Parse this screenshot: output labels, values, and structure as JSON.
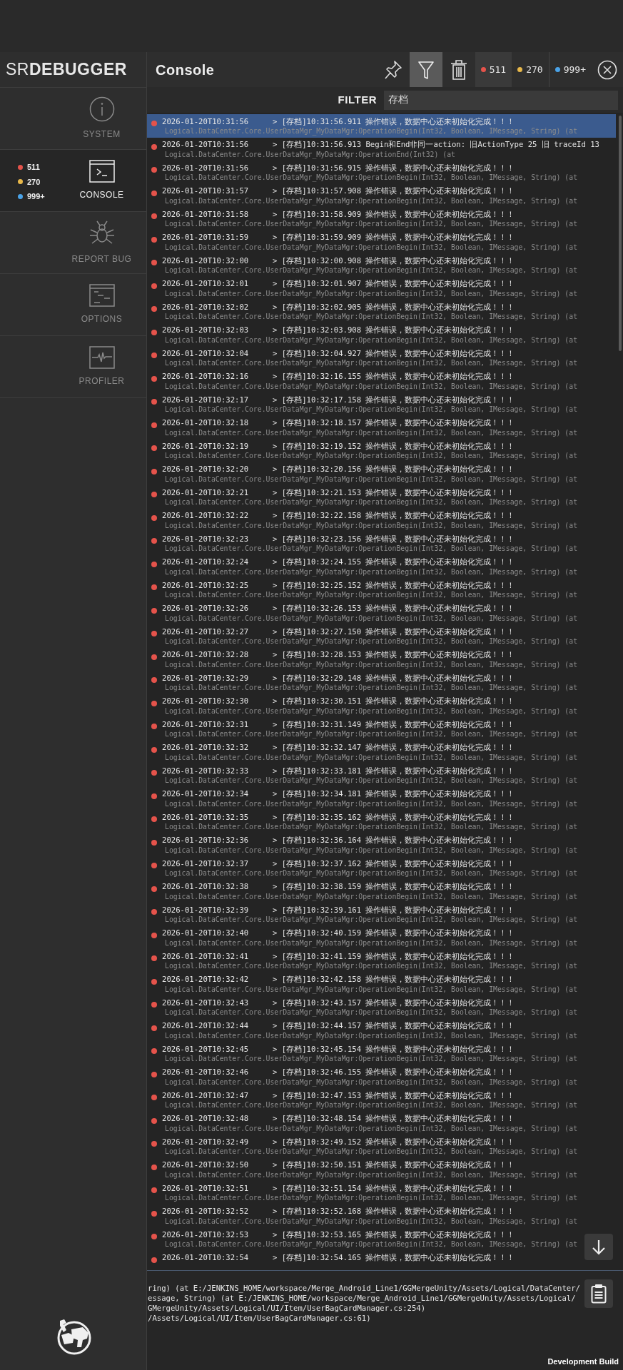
{
  "header": {
    "logo_light": "SR",
    "logo_bold": "DEBUGGER",
    "title": "Console"
  },
  "tool_buttons": [
    {
      "kind": "pin",
      "selected": false
    },
    {
      "kind": "filter",
      "selected": true
    },
    {
      "kind": "trash",
      "selected": false
    }
  ],
  "log_counters": [
    {
      "label": "511",
      "color": "#e5534b",
      "selected": true
    },
    {
      "label": "270",
      "color": "#e8b84a",
      "selected": false
    },
    {
      "label": "999+",
      "color": "#4aa3e8",
      "selected": false
    }
  ],
  "filter": {
    "label": "FILTER",
    "value": "存档"
  },
  "sidebar": {
    "items": [
      {
        "kind": "system",
        "label": "SYSTEM",
        "selected": false
      },
      {
        "kind": "console",
        "label": "CONSOLE",
        "selected": true,
        "counters": [
          {
            "label": "511",
            "color": "#e5534b"
          },
          {
            "label": "270",
            "color": "#e8b84a"
          },
          {
            "label": "999+",
            "color": "#4aa3e8"
          }
        ]
      },
      {
        "kind": "bug",
        "label": "REPORT BUG",
        "selected": false
      },
      {
        "kind": "options",
        "label": "OPTIONS",
        "selected": false
      },
      {
        "kind": "profiler",
        "label": "PROFILER",
        "selected": false
      }
    ]
  },
  "log_rows": [
    {
      "kind": "error",
      "selected": true,
      "time": "2026-01-20T10:31:56",
      "message": "> [存档]10:31:56.911 操作错误，数据中心还未初始化完成！！！",
      "stack": "Logical.DataCenter.Core.UserDataMgr_MyDataMgr:OperationBegin(Int32, Boolean, IMessage, String) (at"
    },
    {
      "kind": "error",
      "selected": false,
      "time": "2026-01-20T10:31:56",
      "message": "> [存档]10:31:56.913 Begin和End非同一action: 旧ActionType 25 旧 traceId 13",
      "stack": "Logical.DataCenter.Core.UserDataMgr_MyDataMgr:OperationEnd(Int32) (at"
    },
    {
      "kind": "error",
      "selected": false,
      "time": "2026-01-20T10:31:56",
      "message": "> [存档]10:31:56.915 操作错误，数据中心还未初始化完成！！！",
      "stack": "Logical.DataCenter.Core.UserDataMgr_MyDataMgr:OperationBegin(Int32, Boolean, IMessage, String) (at"
    },
    {
      "kind": "error",
      "selected": false,
      "time": "2026-01-20T10:31:57",
      "message": "> [存档]10:31:57.908 操作错误，数据中心还未初始化完成！！！",
      "stack": "Logical.DataCenter.Core.UserDataMgr_MyDataMgr:OperationBegin(Int32, Boolean, IMessage, String) (at"
    },
    {
      "kind": "error",
      "selected": false,
      "time": "2026-01-20T10:31:58",
      "message": "> [存档]10:31:58.909 操作错误，数据中心还未初始化完成！！！",
      "stack": "Logical.DataCenter.Core.UserDataMgr_MyDataMgr:OperationBegin(Int32, Boolean, IMessage, String) (at"
    },
    {
      "kind": "error",
      "selected": false,
      "time": "2026-01-20T10:31:59",
      "message": "> [存档]10:31:59.909 操作错误，数据中心还未初始化完成！！！",
      "stack": "Logical.DataCenter.Core.UserDataMgr_MyDataMgr:OperationBegin(Int32, Boolean, IMessage, String) (at"
    },
    {
      "kind": "error",
      "selected": false,
      "time": "2026-01-20T10:32:00",
      "message": "> [存档]10:32:00.908 操作错误，数据中心还未初始化完成！！！",
      "stack": "Logical.DataCenter.Core.UserDataMgr_MyDataMgr:OperationBegin(Int32, Boolean, IMessage, String) (at"
    },
    {
      "kind": "error",
      "selected": false,
      "time": "2026-01-20T10:32:01",
      "message": "> [存档]10:32:01.907 操作错误，数据中心还未初始化完成！！！",
      "stack": "Logical.DataCenter.Core.UserDataMgr_MyDataMgr:OperationBegin(Int32, Boolean, IMessage, String) (at"
    },
    {
      "kind": "error",
      "selected": false,
      "time": "2026-01-20T10:32:02",
      "message": "> [存档]10:32:02.905 操作错误，数据中心还未初始化完成！！！",
      "stack": "Logical.DataCenter.Core.UserDataMgr_MyDataMgr:OperationBegin(Int32, Boolean, IMessage, String) (at"
    },
    {
      "kind": "error",
      "selected": false,
      "time": "2026-01-20T10:32:03",
      "message": "> [存档]10:32:03.908 操作错误，数据中心还未初始化完成！！！",
      "stack": "Logical.DataCenter.Core.UserDataMgr_MyDataMgr:OperationBegin(Int32, Boolean, IMessage, String) (at"
    },
    {
      "kind": "error",
      "selected": false,
      "time": "2026-01-20T10:32:04",
      "message": "> [存档]10:32:04.927 操作错误，数据中心还未初始化完成！！！",
      "stack": "Logical.DataCenter.Core.UserDataMgr_MyDataMgr:OperationBegin(Int32, Boolean, IMessage, String) (at"
    },
    {
      "kind": "error",
      "selected": false,
      "time": "2026-01-20T10:32:16",
      "message": "> [存档]10:32:16.155 操作错误，数据中心还未初始化完成！！！",
      "stack": "Logical.DataCenter.Core.UserDataMgr_MyDataMgr:OperationBegin(Int32, Boolean, IMessage, String) (at"
    },
    {
      "kind": "error",
      "selected": false,
      "time": "2026-01-20T10:32:17",
      "message": "> [存档]10:32:17.158 操作错误，数据中心还未初始化完成！！！",
      "stack": "Logical.DataCenter.Core.UserDataMgr_MyDataMgr:OperationBegin(Int32, Boolean, IMessage, String) (at"
    },
    {
      "kind": "error",
      "selected": false,
      "time": "2026-01-20T10:32:18",
      "message": "> [存档]10:32:18.157 操作错误，数据中心还未初始化完成！！！",
      "stack": "Logical.DataCenter.Core.UserDataMgr_MyDataMgr:OperationBegin(Int32, Boolean, IMessage, String) (at"
    },
    {
      "kind": "error",
      "selected": false,
      "time": "2026-01-20T10:32:19",
      "message": "> [存档]10:32:19.152 操作错误，数据中心还未初始化完成！！！",
      "stack": "Logical.DataCenter.Core.UserDataMgr_MyDataMgr:OperationBegin(Int32, Boolean, IMessage, String) (at"
    },
    {
      "kind": "error",
      "selected": false,
      "time": "2026-01-20T10:32:20",
      "message": "> [存档]10:32:20.156 操作错误，数据中心还未初始化完成！！！",
      "stack": "Logical.DataCenter.Core.UserDataMgr_MyDataMgr:OperationBegin(Int32, Boolean, IMessage, String) (at"
    },
    {
      "kind": "error",
      "selected": false,
      "time": "2026-01-20T10:32:21",
      "message": "> [存档]10:32:21.153 操作错误，数据中心还未初始化完成！！！",
      "stack": "Logical.DataCenter.Core.UserDataMgr_MyDataMgr:OperationBegin(Int32, Boolean, IMessage, String) (at"
    },
    {
      "kind": "error",
      "selected": false,
      "time": "2026-01-20T10:32:22",
      "message": "> [存档]10:32:22.158 操作错误，数据中心还未初始化完成！！！",
      "stack": "Logical.DataCenter.Core.UserDataMgr_MyDataMgr:OperationBegin(Int32, Boolean, IMessage, String) (at"
    },
    {
      "kind": "error",
      "selected": false,
      "time": "2026-01-20T10:32:23",
      "message": "> [存档]10:32:23.156 操作错误，数据中心还未初始化完成！！！",
      "stack": "Logical.DataCenter.Core.UserDataMgr_MyDataMgr:OperationBegin(Int32, Boolean, IMessage, String) (at"
    },
    {
      "kind": "error",
      "selected": false,
      "time": "2026-01-20T10:32:24",
      "message": "> [存档]10:32:24.155 操作错误，数据中心还未初始化完成！！！",
      "stack": "Logical.DataCenter.Core.UserDataMgr_MyDataMgr:OperationBegin(Int32, Boolean, IMessage, String) (at"
    },
    {
      "kind": "error",
      "selected": false,
      "time": "2026-01-20T10:32:25",
      "message": "> [存档]10:32:25.152 操作错误，数据中心还未初始化完成！！！",
      "stack": "Logical.DataCenter.Core.UserDataMgr_MyDataMgr:OperationBegin(Int32, Boolean, IMessage, String) (at"
    },
    {
      "kind": "error",
      "selected": false,
      "time": "2026-01-20T10:32:26",
      "message": "> [存档]10:32:26.153 操作错误，数据中心还未初始化完成！！！",
      "stack": "Logical.DataCenter.Core.UserDataMgr_MyDataMgr:OperationBegin(Int32, Boolean, IMessage, String) (at"
    },
    {
      "kind": "error",
      "selected": false,
      "time": "2026-01-20T10:32:27",
      "message": "> [存档]10:32:27.150 操作错误，数据中心还未初始化完成！！！",
      "stack": "Logical.DataCenter.Core.UserDataMgr_MyDataMgr:OperationBegin(Int32, Boolean, IMessage, String) (at"
    },
    {
      "kind": "error",
      "selected": false,
      "time": "2026-01-20T10:32:28",
      "message": "> [存档]10:32:28.153 操作错误，数据中心还未初始化完成！！！",
      "stack": "Logical.DataCenter.Core.UserDataMgr_MyDataMgr:OperationBegin(Int32, Boolean, IMessage, String) (at"
    },
    {
      "kind": "error",
      "selected": false,
      "time": "2026-01-20T10:32:29",
      "message": "> [存档]10:32:29.148 操作错误，数据中心还未初始化完成！！！",
      "stack": "Logical.DataCenter.Core.UserDataMgr_MyDataMgr:OperationBegin(Int32, Boolean, IMessage, String) (at"
    },
    {
      "kind": "error",
      "selected": false,
      "time": "2026-01-20T10:32:30",
      "message": "> [存档]10:32:30.151 操作错误，数据中心还未初始化完成！！！",
      "stack": "Logical.DataCenter.Core.UserDataMgr_MyDataMgr:OperationBegin(Int32, Boolean, IMessage, String) (at"
    },
    {
      "kind": "error",
      "selected": false,
      "time": "2026-01-20T10:32:31",
      "message": "> [存档]10:32:31.149 操作错误，数据中心还未初始化完成！！！",
      "stack": "Logical.DataCenter.Core.UserDataMgr_MyDataMgr:OperationBegin(Int32, Boolean, IMessage, String) (at"
    },
    {
      "kind": "error",
      "selected": false,
      "time": "2026-01-20T10:32:32",
      "message": "> [存档]10:32:32.147 操作错误，数据中心还未初始化完成！！！",
      "stack": "Logical.DataCenter.Core.UserDataMgr_MyDataMgr:OperationBegin(Int32, Boolean, IMessage, String) (at"
    },
    {
      "kind": "error",
      "selected": false,
      "time": "2026-01-20T10:32:33",
      "message": "> [存档]10:32:33.181 操作错误，数据中心还未初始化完成！！！",
      "stack": "Logical.DataCenter.Core.UserDataMgr_MyDataMgr:OperationBegin(Int32, Boolean, IMessage, String) (at"
    },
    {
      "kind": "error",
      "selected": false,
      "time": "2026-01-20T10:32:34",
      "message": "> [存档]10:32:34.181 操作错误，数据中心还未初始化完成！！！",
      "stack": "Logical.DataCenter.Core.UserDataMgr_MyDataMgr:OperationBegin(Int32, Boolean, IMessage, String) (at"
    },
    {
      "kind": "error",
      "selected": false,
      "time": "2026-01-20T10:32:35",
      "message": "> [存档]10:32:35.162 操作错误，数据中心还未初始化完成！！！",
      "stack": "Logical.DataCenter.Core.UserDataMgr_MyDataMgr:OperationBegin(Int32, Boolean, IMessage, String) (at"
    },
    {
      "kind": "error",
      "selected": false,
      "time": "2026-01-20T10:32:36",
      "message": "> [存档]10:32:36.164 操作错误，数据中心还未初始化完成！！！",
      "stack": "Logical.DataCenter.Core.UserDataMgr_MyDataMgr:OperationBegin(Int32, Boolean, IMessage, String) (at"
    },
    {
      "kind": "error",
      "selected": false,
      "time": "2026-01-20T10:32:37",
      "message": "> [存档]10:32:37.162 操作错误，数据中心还未初始化完成！！！",
      "stack": "Logical.DataCenter.Core.UserDataMgr_MyDataMgr:OperationBegin(Int32, Boolean, IMessage, String) (at"
    },
    {
      "kind": "error",
      "selected": false,
      "time": "2026-01-20T10:32:38",
      "message": "> [存档]10:32:38.159 操作错误，数据中心还未初始化完成！！！",
      "stack": "Logical.DataCenter.Core.UserDataMgr_MyDataMgr:OperationBegin(Int32, Boolean, IMessage, String) (at"
    },
    {
      "kind": "error",
      "selected": false,
      "time": "2026-01-20T10:32:39",
      "message": "> [存档]10:32:39.161 操作错误，数据中心还未初始化完成！！！",
      "stack": "Logical.DataCenter.Core.UserDataMgr_MyDataMgr:OperationBegin(Int32, Boolean, IMessage, String) (at"
    },
    {
      "kind": "error",
      "selected": false,
      "time": "2026-01-20T10:32:40",
      "message": "> [存档]10:32:40.159 操作错误，数据中心还未初始化完成！！！",
      "stack": "Logical.DataCenter.Core.UserDataMgr_MyDataMgr:OperationBegin(Int32, Boolean, IMessage, String) (at"
    },
    {
      "kind": "error",
      "selected": false,
      "time": "2026-01-20T10:32:41",
      "message": "> [存档]10:32:41.159 操作错误，数据中心还未初始化完成！！！",
      "stack": "Logical.DataCenter.Core.UserDataMgr_MyDataMgr:OperationBegin(Int32, Boolean, IMessage, String) (at"
    },
    {
      "kind": "error",
      "selected": false,
      "time": "2026-01-20T10:32:42",
      "message": "> [存档]10:32:42.158 操作错误，数据中心还未初始化完成！！！",
      "stack": "Logical.DataCenter.Core.UserDataMgr_MyDataMgr:OperationBegin(Int32, Boolean, IMessage, String) (at"
    },
    {
      "kind": "error",
      "selected": false,
      "time": "2026-01-20T10:32:43",
      "message": "> [存档]10:32:43.157 操作错误，数据中心还未初始化完成！！！",
      "stack": "Logical.DataCenter.Core.UserDataMgr_MyDataMgr:OperationBegin(Int32, Boolean, IMessage, String) (at"
    },
    {
      "kind": "error",
      "selected": false,
      "time": "2026-01-20T10:32:44",
      "message": "> [存档]10:32:44.157 操作错误，数据中心还未初始化完成！！！",
      "stack": "Logical.DataCenter.Core.UserDataMgr_MyDataMgr:OperationBegin(Int32, Boolean, IMessage, String) (at"
    },
    {
      "kind": "error",
      "selected": false,
      "time": "2026-01-20T10:32:45",
      "message": "> [存档]10:32:45.154 操作错误，数据中心还未初始化完成！！！",
      "stack": "Logical.DataCenter.Core.UserDataMgr_MyDataMgr:OperationBegin(Int32, Boolean, IMessage, String) (at"
    },
    {
      "kind": "error",
      "selected": false,
      "time": "2026-01-20T10:32:46",
      "message": "> [存档]10:32:46.155 操作错误，数据中心还未初始化完成！！！",
      "stack": "Logical.DataCenter.Core.UserDataMgr_MyDataMgr:OperationBegin(Int32, Boolean, IMessage, String) (at"
    },
    {
      "kind": "error",
      "selected": false,
      "time": "2026-01-20T10:32:47",
      "message": "> [存档]10:32:47.153 操作错误，数据中心还未初始化完成！！！",
      "stack": "Logical.DataCenter.Core.UserDataMgr_MyDataMgr:OperationBegin(Int32, Boolean, IMessage, String) (at"
    },
    {
      "kind": "error",
      "selected": false,
      "time": "2026-01-20T10:32:48",
      "message": "> [存档]10:32:48.154 操作错误，数据中心还未初始化完成！！！",
      "stack": "Logical.DataCenter.Core.UserDataMgr_MyDataMgr:OperationBegin(Int32, Boolean, IMessage, String) (at"
    },
    {
      "kind": "error",
      "selected": false,
      "time": "2026-01-20T10:32:49",
      "message": "> [存档]10:32:49.152 操作错误，数据中心还未初始化完成！！！",
      "stack": "Logical.DataCenter.Core.UserDataMgr_MyDataMgr:OperationBegin(Int32, Boolean, IMessage, String) (at"
    },
    {
      "kind": "error",
      "selected": false,
      "time": "2026-01-20T10:32:50",
      "message": "> [存档]10:32:50.151 操作错误，数据中心还未初始化完成！！！",
      "stack": "Logical.DataCenter.Core.UserDataMgr_MyDataMgr:OperationBegin(Int32, Boolean, IMessage, String) (at"
    },
    {
      "kind": "error",
      "selected": false,
      "time": "2026-01-20T10:32:51",
      "message": "> [存档]10:32:51.154 操作错误，数据中心还未初始化完成！！！",
      "stack": "Logical.DataCenter.Core.UserDataMgr_MyDataMgr:OperationBegin(Int32, Boolean, IMessage, String) (at"
    },
    {
      "kind": "error",
      "selected": false,
      "time": "2026-01-20T10:32:52",
      "message": "> [存档]10:32:52.168 操作错误，数据中心还未初始化完成！！！",
      "stack": "Logical.DataCenter.Core.UserDataMgr_MyDataMgr:OperationBegin(Int32, Boolean, IMessage, String) (at"
    },
    {
      "kind": "error",
      "selected": false,
      "time": "2026-01-20T10:32:53",
      "message": "> [存档]10:32:53.165 操作错误，数据中心还未初始化完成！！！",
      "stack": "Logical.DataCenter.Core.UserDataMgr_MyDataMgr:OperationBegin(Int32, Boolean, IMessage, String) (at"
    },
    {
      "kind": "error",
      "selected": false,
      "time": "2026-01-20T10:32:54",
      "message": "> [存档]10:32:54.165 操作错误，数据中心还未初始化完成！！！"
    }
  ],
  "detail": {
    "lines": [
      "ring) (at E:/JENKINS_HOME/workspace/Merge_Android_Line1/GGMergeUnity/Assets/Logical/DataCenter/",
      "essage, String) (at E:/JENKINS_HOME/workspace/Merge_Android_Line1/GGMergeUnity/Assets/Logical/",
      "GMergeUnity/Assets/Logical/UI/Item/UserBagCardManager.cs:254)",
      "/Assets/Logical/UI/Item/UserBagCardManager.cs:61)"
    ]
  },
  "footer": "Development Build"
}
